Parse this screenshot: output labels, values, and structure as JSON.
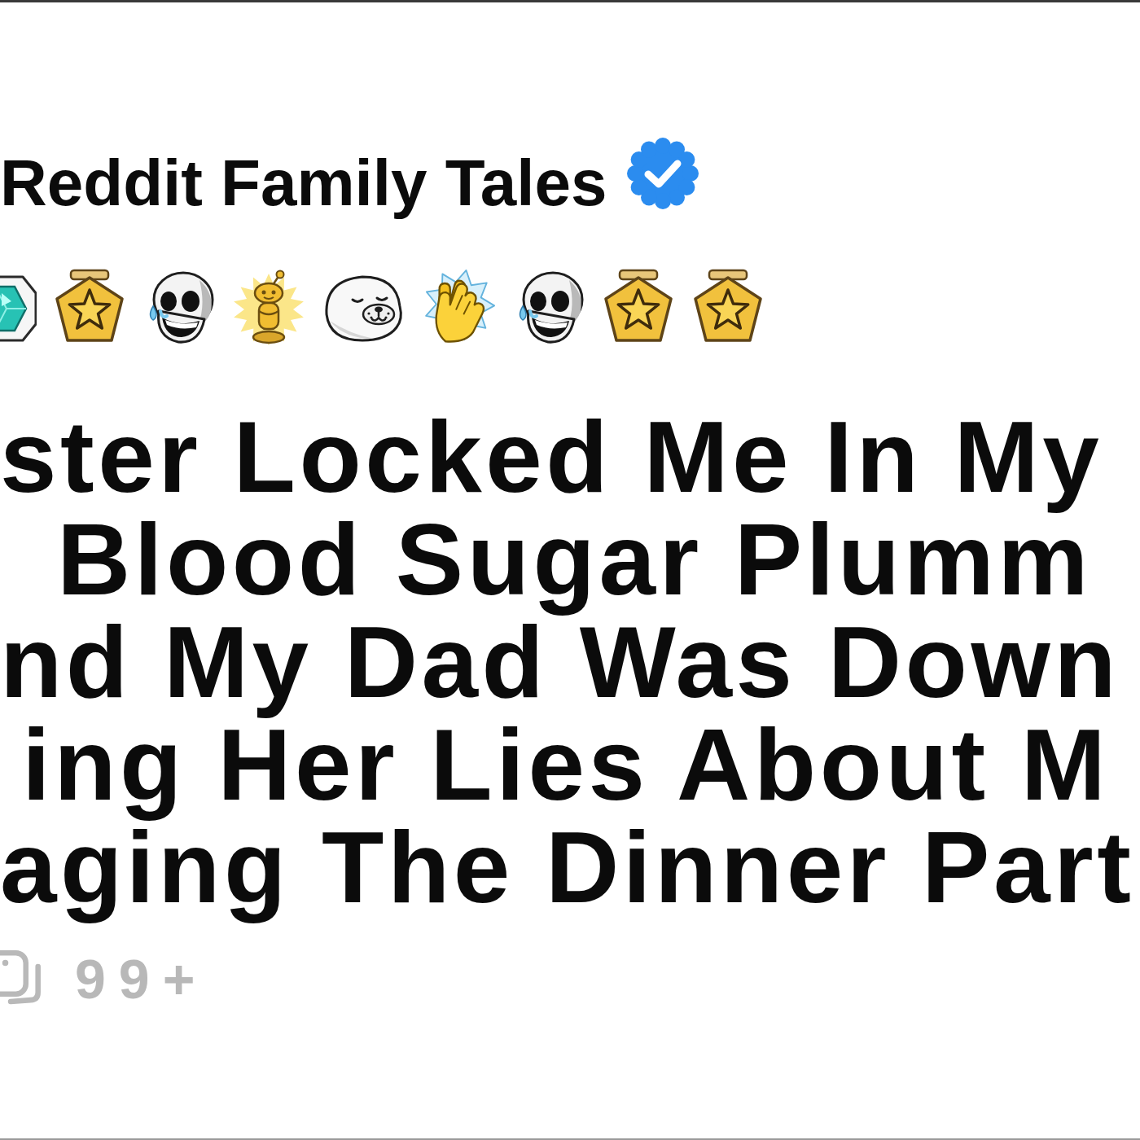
{
  "header": {
    "channel_name": "Reddit Family Tales",
    "verified": true
  },
  "awards": [
    {
      "kind": "gem"
    },
    {
      "kind": "star_medal"
    },
    {
      "kind": "skull"
    },
    {
      "kind": "golden_figure"
    },
    {
      "kind": "seal"
    },
    {
      "kind": "clapping_hands"
    },
    {
      "kind": "skull"
    },
    {
      "kind": "star_medal"
    },
    {
      "kind": "star_medal"
    }
  ],
  "title_lines": [
    "ster Locked Me In My",
    "Blood Sugar Plumm",
    "nd My Dad Was Down",
    "ing Her Lies About M",
    "aging The Dinner Part"
  ],
  "comments": {
    "count": "99+"
  }
}
